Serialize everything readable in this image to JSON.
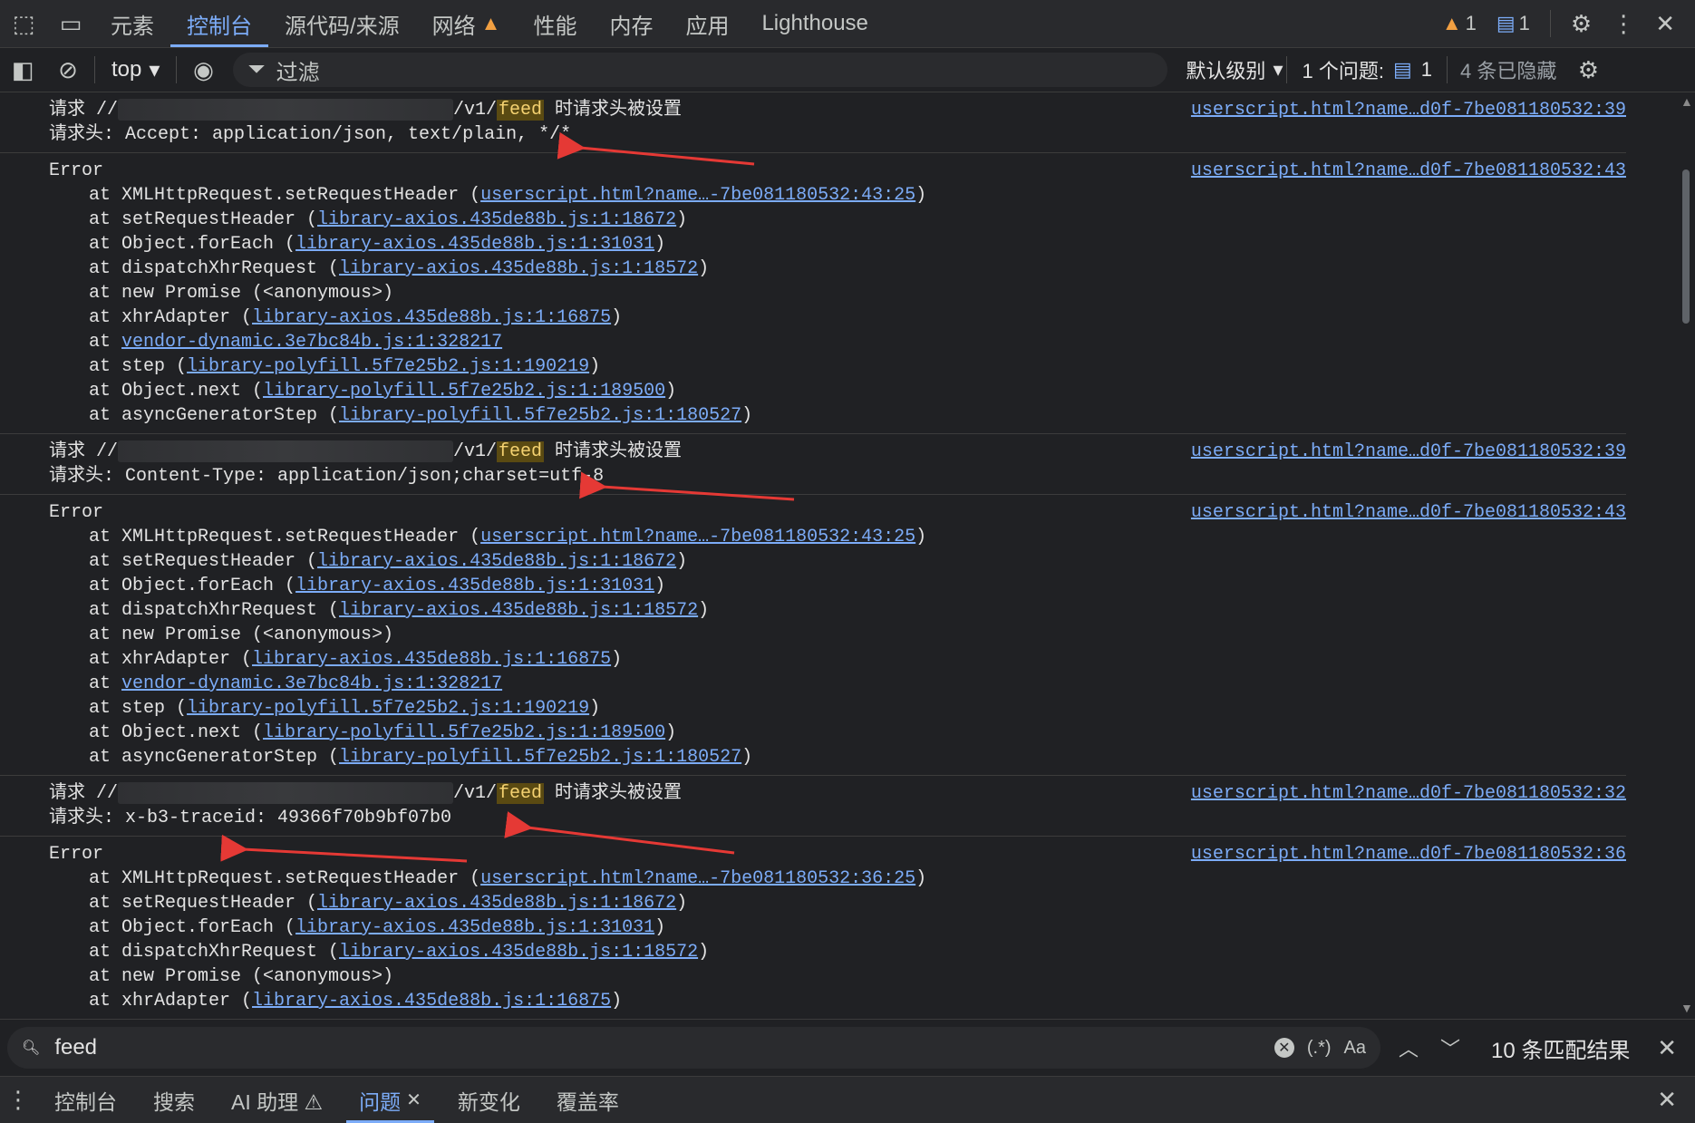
{
  "tabbar": {
    "tabs": [
      {
        "label": "元素"
      },
      {
        "label": "控制台"
      },
      {
        "label": "源代码/来源"
      },
      {
        "label": "网络"
      },
      {
        "label": "性能"
      },
      {
        "label": "内存"
      },
      {
        "label": "应用"
      },
      {
        "label": "Lighthouse"
      }
    ],
    "active_tab": "控制台",
    "warning_count": "1",
    "message_count": "1"
  },
  "toolbar": {
    "context": "top",
    "filter_placeholder": "过滤",
    "level": "默认级别",
    "issues_label": "1 个问题:",
    "issues_count": "1",
    "hidden": "4 条已隐藏"
  },
  "console": {
    "request_blocks": [
      {
        "prefix": "请求 //",
        "path": "/v1/",
        "keyword": "feed",
        "suffix": " 时请求头被设置",
        "header": "请求头: Accept: application/json, text/plain, */*",
        "source": "userscript.html?name…d0f-7be081180532:39"
      },
      {
        "prefix": "请求 //",
        "path": "/v1/",
        "keyword": "feed",
        "suffix": " 时请求头被设置",
        "header": "请求头: Content-Type: application/json;charset=utf-8",
        "source": "userscript.html?name…d0f-7be081180532:39"
      },
      {
        "prefix": "请求 //",
        "path": "/v1/",
        "keyword": "feed",
        "suffix": " 时请求头被设置",
        "header": "请求头: x-b3-traceid: 49366f70b9bf07b0",
        "source": "userscript.html?name…d0f-7be081180532:32"
      }
    ],
    "error_blocks": [
      {
        "title": "Error",
        "source": "userscript.html?name…d0f-7be081180532:43",
        "frames": [
          {
            "fn": "at XMLHttpRequest.setRequestHeader (",
            "link": "userscript.html?name…-7be081180532:43:25",
            "end": ")"
          },
          {
            "fn": "at setRequestHeader (",
            "link": "library-axios.435de88b.js:1:18672",
            "end": ")"
          },
          {
            "fn": "at Object.forEach (",
            "link": "library-axios.435de88b.js:1:31031",
            "end": ")"
          },
          {
            "fn": "at dispatchXhrRequest (",
            "link": "library-axios.435de88b.js:1:18572",
            "end": ")"
          },
          {
            "fn": "at new Promise (<anonymous>)",
            "link": "",
            "end": ""
          },
          {
            "fn": "at xhrAdapter (",
            "link": "library-axios.435de88b.js:1:16875",
            "end": ")"
          },
          {
            "fn": "at ",
            "link": "vendor-dynamic.3e7bc84b.js:1:328217",
            "end": ""
          },
          {
            "fn": "at step (",
            "link": "library-polyfill.5f7e25b2.js:1:190219",
            "end": ")"
          },
          {
            "fn": "at Object.next (",
            "link": "library-polyfill.5f7e25b2.js:1:189500",
            "end": ")"
          },
          {
            "fn": "at asyncGeneratorStep (",
            "link": "library-polyfill.5f7e25b2.js:1:180527",
            "end": ")"
          }
        ]
      },
      {
        "title": "Error",
        "source": "userscript.html?name…d0f-7be081180532:43",
        "frames": [
          {
            "fn": "at XMLHttpRequest.setRequestHeader (",
            "link": "userscript.html?name…-7be081180532:43:25",
            "end": ")"
          },
          {
            "fn": "at setRequestHeader (",
            "link": "library-axios.435de88b.js:1:18672",
            "end": ")"
          },
          {
            "fn": "at Object.forEach (",
            "link": "library-axios.435de88b.js:1:31031",
            "end": ")"
          },
          {
            "fn": "at dispatchXhrRequest (",
            "link": "library-axios.435de88b.js:1:18572",
            "end": ")"
          },
          {
            "fn": "at new Promise (<anonymous>)",
            "link": "",
            "end": ""
          },
          {
            "fn": "at xhrAdapter (",
            "link": "library-axios.435de88b.js:1:16875",
            "end": ")"
          },
          {
            "fn": "at ",
            "link": "vendor-dynamic.3e7bc84b.js:1:328217",
            "end": ""
          },
          {
            "fn": "at step (",
            "link": "library-polyfill.5f7e25b2.js:1:190219",
            "end": ")"
          },
          {
            "fn": "at Object.next (",
            "link": "library-polyfill.5f7e25b2.js:1:189500",
            "end": ")"
          },
          {
            "fn": "at asyncGeneratorStep (",
            "link": "library-polyfill.5f7e25b2.js:1:180527",
            "end": ")"
          }
        ]
      },
      {
        "title": "Error",
        "source": "userscript.html?name…d0f-7be081180532:36",
        "frames": [
          {
            "fn": "at XMLHttpRequest.setRequestHeader (",
            "link": "userscript.html?name…-7be081180532:36:25",
            "end": ")"
          },
          {
            "fn": "at setRequestHeader (",
            "link": "library-axios.435de88b.js:1:18672",
            "end": ")"
          },
          {
            "fn": "at Object.forEach (",
            "link": "library-axios.435de88b.js:1:31031",
            "end": ")"
          },
          {
            "fn": "at dispatchXhrRequest (",
            "link": "library-axios.435de88b.js:1:18572",
            "end": ")"
          },
          {
            "fn": "at new Promise (<anonymous>)",
            "link": "",
            "end": ""
          },
          {
            "fn": "at xhrAdapter (",
            "link": "library-axios.435de88b.js:1:16875",
            "end": ")"
          }
        ]
      }
    ]
  },
  "search": {
    "value": "feed",
    "regex_label": "(.*)",
    "case_label": "Aa",
    "matches": "10 条匹配结果"
  },
  "drawer": {
    "tabs": [
      {
        "label": "控制台"
      },
      {
        "label": "搜索"
      },
      {
        "label": "AI 助理 ⚠"
      },
      {
        "label": "问题"
      },
      {
        "label": "新变化"
      },
      {
        "label": "覆盖率"
      }
    ],
    "active_tab": "问题"
  },
  "colors": {
    "background": "#202124",
    "link": "#7cacf8",
    "warning": "#f2a042",
    "annotation_arrow": "#e53935"
  }
}
